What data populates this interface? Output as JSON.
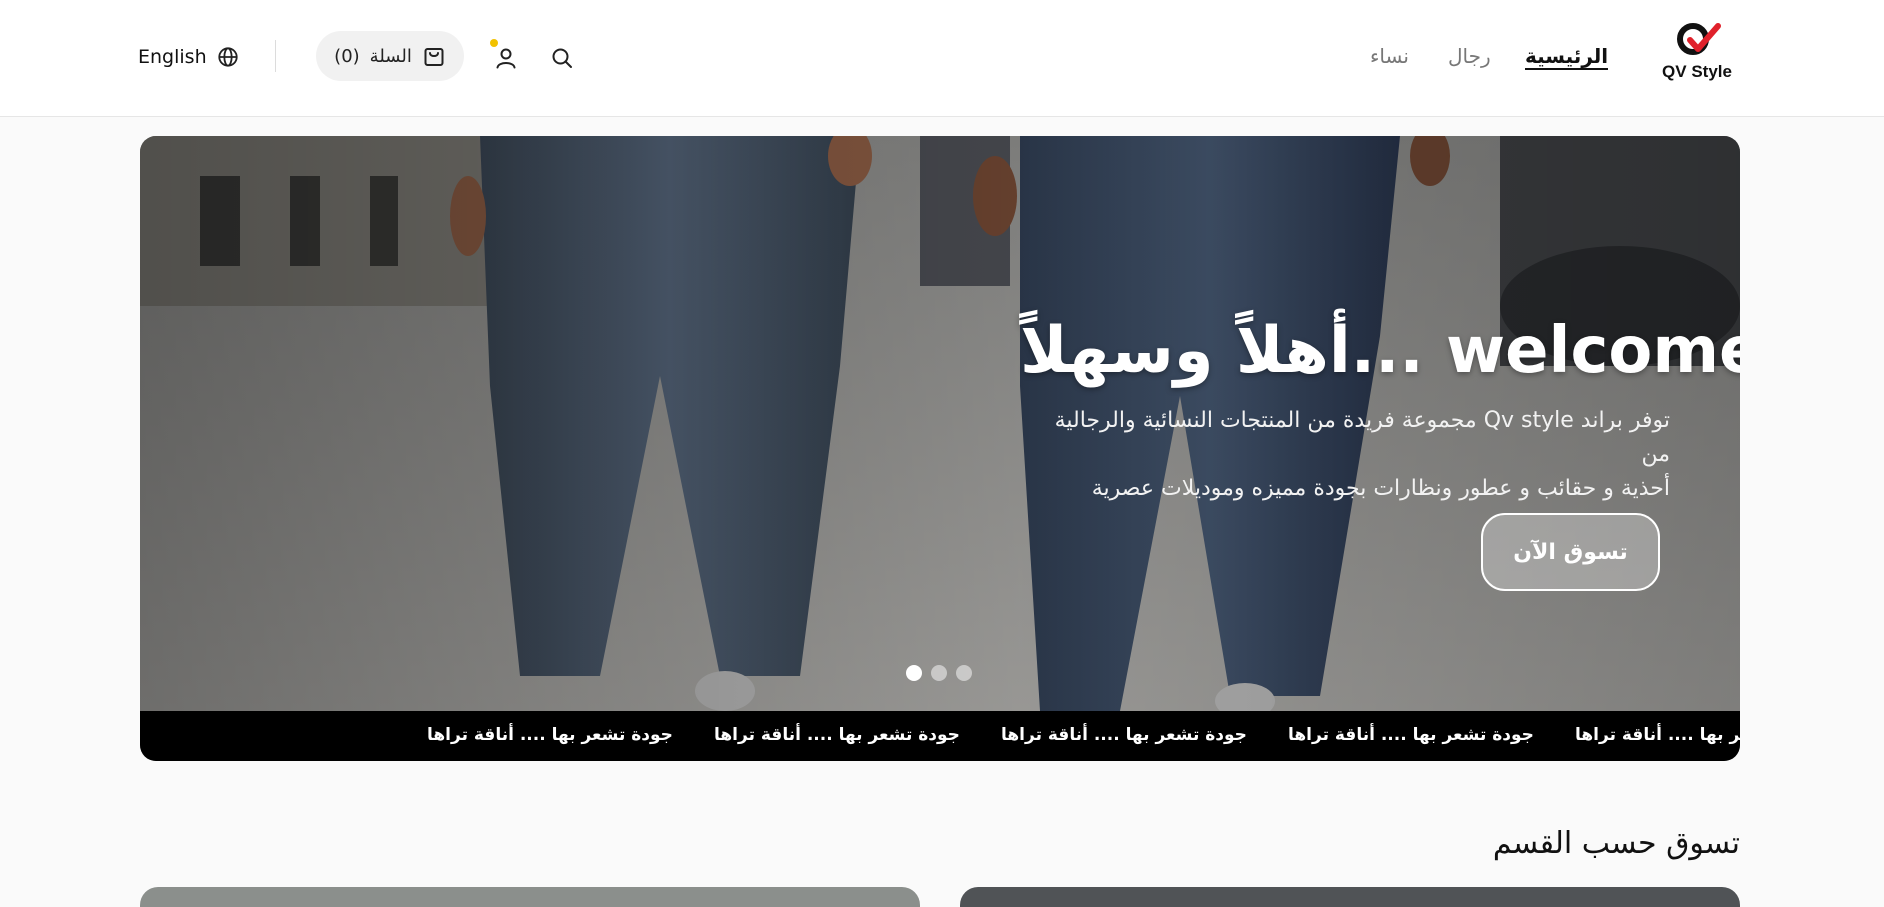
{
  "header": {
    "logo_text": "QV Style",
    "nav": [
      {
        "label": "الرئيسية",
        "active": true
      },
      {
        "label": "رجال",
        "active": false
      },
      {
        "label": "نساء",
        "active": false
      }
    ],
    "cart_label": "السلة",
    "cart_count": "(0)",
    "language": "English",
    "icons": [
      "search-icon",
      "user-icon",
      "cart-icon",
      "globe-icon"
    ],
    "notification_dot_color": "#f2c200"
  },
  "hero": {
    "title": "أهلاً وسهلاً... welcome",
    "description_line1": "توفر براند Qv style مجموعة فريدة من المنتجات النسائية والرجالية من",
    "description_line2": "أحذية و حقائب و عطور ونظارات بجودة مميزه وموديلات عصرية",
    "cta": "تسوق الآن",
    "slides_total": 3,
    "active_slide": 1
  },
  "ticker": {
    "items": [
      "جودة تشعر بها .... أناقة تراها",
      "جودة تشعر بها .... أناقة تراها",
      "جودة تشعر بها .... أناقة تراها",
      "جودة تشعر بها .... أناقة تراها",
      "جودة تشعر بها .... أناقة تراها"
    ]
  },
  "section": {
    "title": "تسوق حسب القسم"
  }
}
